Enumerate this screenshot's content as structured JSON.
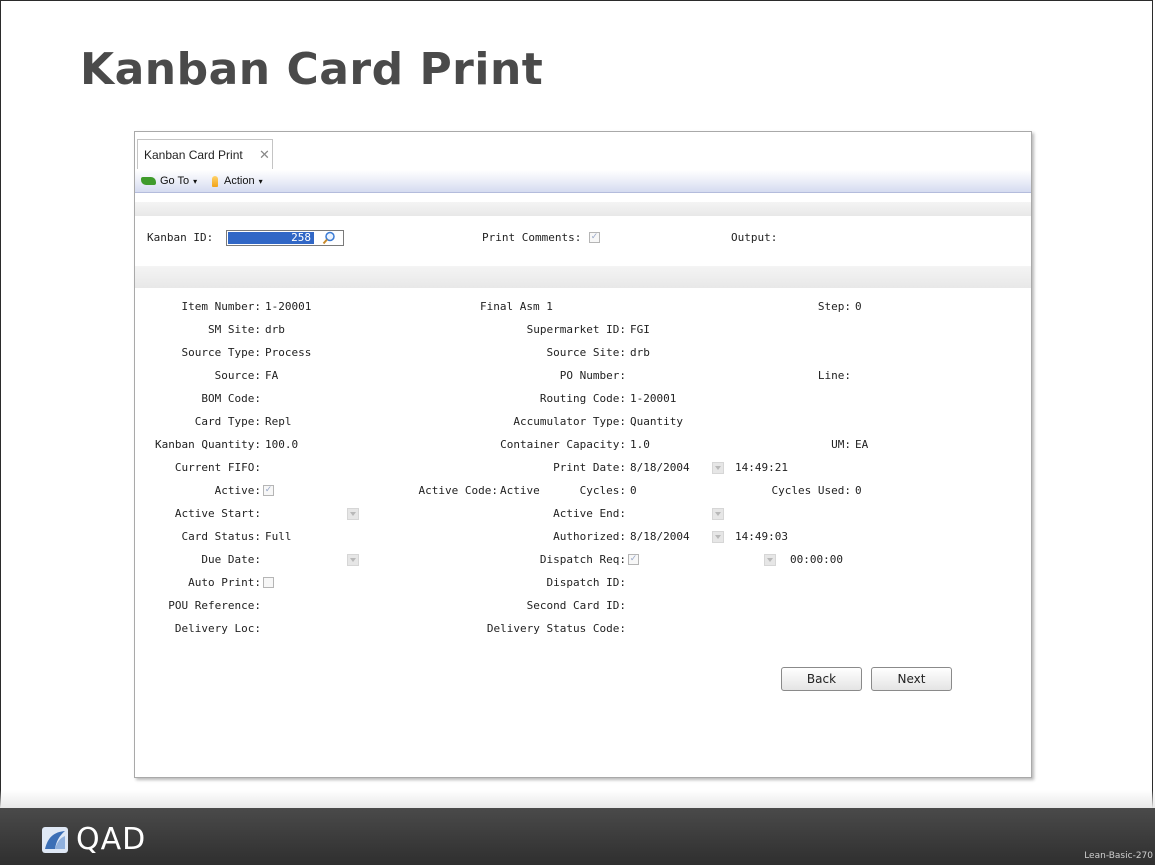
{
  "slide": {
    "title": "Kanban Card Print",
    "logo_text": "QAD",
    "page_id": "Lean-Basic-270",
    "logo_icon": "qad-logo-icon"
  },
  "window": {
    "tab_label": "Kanban Card Print",
    "tab_close": "✕",
    "toolbar": {
      "goto_label": "Go To",
      "action_label": "Action",
      "caret": "▾"
    }
  },
  "header_form": {
    "kanban_id_label": "Kanban ID:",
    "kanban_id_value": "258",
    "print_comments_label": "Print Comments:",
    "print_comments_checked": true,
    "output_label": "Output:"
  },
  "fields": {
    "item_number": {
      "label": "Item Number:",
      "value": "1-20001"
    },
    "item_desc": "Final Asm 1",
    "step": {
      "label": "Step:",
      "value": "0"
    },
    "sm_site": {
      "label": "SM Site:",
      "value": "drb"
    },
    "supermarket_id": {
      "label": "Supermarket ID:",
      "value": "FGI"
    },
    "source_type": {
      "label": "Source Type:",
      "value": "Process"
    },
    "source_site": {
      "label": "Source Site:",
      "value": "drb"
    },
    "source": {
      "label": "Source:",
      "value": "FA"
    },
    "po_number": {
      "label": "PO Number:",
      "value": ""
    },
    "line": {
      "label": "Line:",
      "value": ""
    },
    "bom_code": {
      "label": "BOM Code:",
      "value": ""
    },
    "routing_code": {
      "label": "Routing Code:",
      "value": "1-20001"
    },
    "card_type": {
      "label": "Card Type:",
      "value": "Repl"
    },
    "accumulator_type": {
      "label": "Accumulator Type:",
      "value": "Quantity"
    },
    "kanban_quantity": {
      "label": "Kanban Quantity:",
      "value": "100.0"
    },
    "container_capacity": {
      "label": "Container Capacity:",
      "value": "1.0"
    },
    "um": {
      "label": "UM:",
      "value": "EA"
    },
    "current_fifo": {
      "label": "Current FIFO:",
      "value": ""
    },
    "print_date": {
      "label": "Print Date:",
      "value": "8/18/2004",
      "time": "14:49:21"
    },
    "active": {
      "label": "Active:",
      "checked": true
    },
    "active_code": {
      "label": "Active Code:",
      "value": "Active"
    },
    "cycles": {
      "label": "Cycles:",
      "value": "0"
    },
    "cycles_used": {
      "label": "Cycles Used:",
      "value": "0"
    },
    "active_start": {
      "label": "Active Start:",
      "value": ""
    },
    "active_end": {
      "label": "Active End:",
      "value": ""
    },
    "card_status": {
      "label": "Card Status:",
      "value": "Full"
    },
    "authorized": {
      "label": "Authorized:",
      "value": "8/18/2004",
      "time": "14:49:03"
    },
    "due_date": {
      "label": "Due Date:",
      "value": ""
    },
    "dispatch_req": {
      "label": "Dispatch Req:",
      "checked": true,
      "time": "00:00:00"
    },
    "auto_print": {
      "label": "Auto Print:",
      "checked": false
    },
    "dispatch_id": {
      "label": "Dispatch ID:",
      "value": ""
    },
    "pou_reference": {
      "label": "POU Reference:",
      "value": ""
    },
    "second_card_id": {
      "label": "Second Card ID:",
      "value": ""
    },
    "delivery_loc": {
      "label": "Delivery Loc:",
      "value": ""
    },
    "delivery_status_code": {
      "label": "Delivery Status Code:",
      "value": ""
    }
  },
  "buttons": {
    "back": "Back",
    "next": "Next"
  },
  "colors": {
    "selection": "#3167c6",
    "toolbar_border": "#b4bcdc",
    "footer": "#3a3a3a"
  }
}
